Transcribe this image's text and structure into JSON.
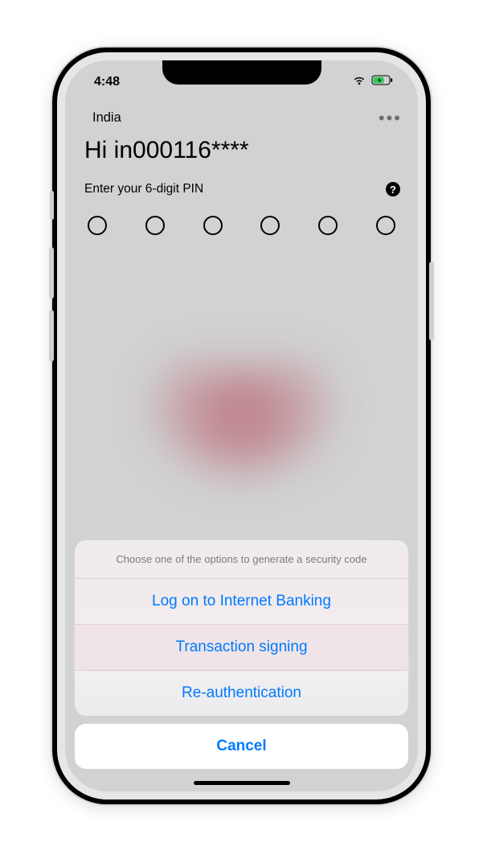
{
  "status": {
    "time": "4:48"
  },
  "nav": {
    "title": "India"
  },
  "greeting": "Hi in000116****",
  "pin": {
    "label": "Enter your 6-digit PIN",
    "count": 6
  },
  "sheet": {
    "header": "Choose one of the options to generate a security code",
    "options": [
      "Log on to Internet Banking",
      "Transaction signing",
      "Re-authentication"
    ],
    "cancel": "Cancel"
  }
}
